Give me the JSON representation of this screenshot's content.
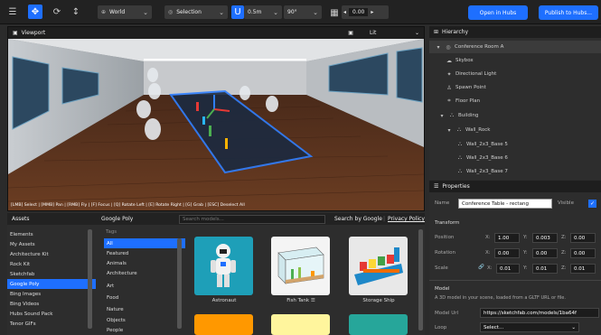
{
  "toolbar": {
    "space": "World",
    "mode": "Selection",
    "snap": "0.5m",
    "rotation": "90°",
    "grid_value": "0.00",
    "open_button": "Open in Hubs",
    "publish_button": "Publish to Hubs..."
  },
  "viewport": {
    "title": "Viewport",
    "view_mode": "Lit",
    "hint": "[LMB] Select | [MMB] Pan | [RMB] Fly | [F] Focus | [Q] Rotate Left | [E] Rotate Right | [G] Grab | [ESC] Deselect All"
  },
  "hierarchy": {
    "title": "Hierarchy",
    "items": [
      {
        "label": "Conference Room A",
        "icon": "scene-icon"
      },
      {
        "label": "Skybox",
        "icon": "skybox-icon"
      },
      {
        "label": "Directional Light",
        "icon": "light-icon"
      },
      {
        "label": "Spawn Point",
        "icon": "spawn-icon"
      },
      {
        "label": "Floor Plan",
        "icon": "floor-plan-icon"
      },
      {
        "label": "Building",
        "icon": "model-icon"
      },
      {
        "label": "Wall_Rock",
        "icon": "model-icon"
      },
      {
        "label": "Wall_2x3_Base 5",
        "icon": "model-icon"
      },
      {
        "label": "Wall_2x3_Base 6",
        "icon": "model-icon"
      },
      {
        "label": "Wall_2x3_Base 7",
        "icon": "model-icon"
      }
    ]
  },
  "properties": {
    "title": "Properties",
    "name_label": "Name",
    "name_value": "Conference Table - rectang",
    "visible_label": "Visible",
    "transform_label": "Transform",
    "position_label": "Position",
    "rotation_label": "Rotation",
    "scale_label": "Scale",
    "axes": [
      "X:",
      "Y:",
      "Z:"
    ],
    "position": [
      "1.00",
      "0.003",
      "0.00"
    ],
    "rotation": [
      "0.00",
      "0.00",
      "0.00"
    ],
    "scale": [
      "0.01",
      "0.01",
      "0.01"
    ],
    "model_label": "Model",
    "model_desc": "A 3D model in your scene, loaded from a GLTF URL or file.",
    "model_url_label": "Model Url",
    "model_url_value": "https://sketchfab.com/models/1ba64f",
    "loop_label": "Loop",
    "loop_value": "Select..."
  },
  "assets": {
    "title": "Assets",
    "sources": [
      "Elements",
      "My Assets",
      "Architecture Kit",
      "Rock Kit",
      "Sketchfab",
      "Google Poly",
      "Bing Images",
      "Bing Videos",
      "Hubs Sound Pack",
      "Tenor GIFs"
    ],
    "active_source": "Google Poly",
    "provider_title": "Google Poly",
    "tags_label": "Tags",
    "tags": [
      "All",
      "Featured",
      "Animals",
      "Architecture",
      "Art",
      "Food",
      "Nature",
      "Objects",
      "People"
    ],
    "search_placeholder": "Search models...",
    "search_by": "Search by Google",
    "privacy_link": "Privacy Policy",
    "results": [
      "Astronaut",
      "Fish Tank",
      "Storage Ship"
    ],
    "fish_tank_suffix": "☰"
  }
}
